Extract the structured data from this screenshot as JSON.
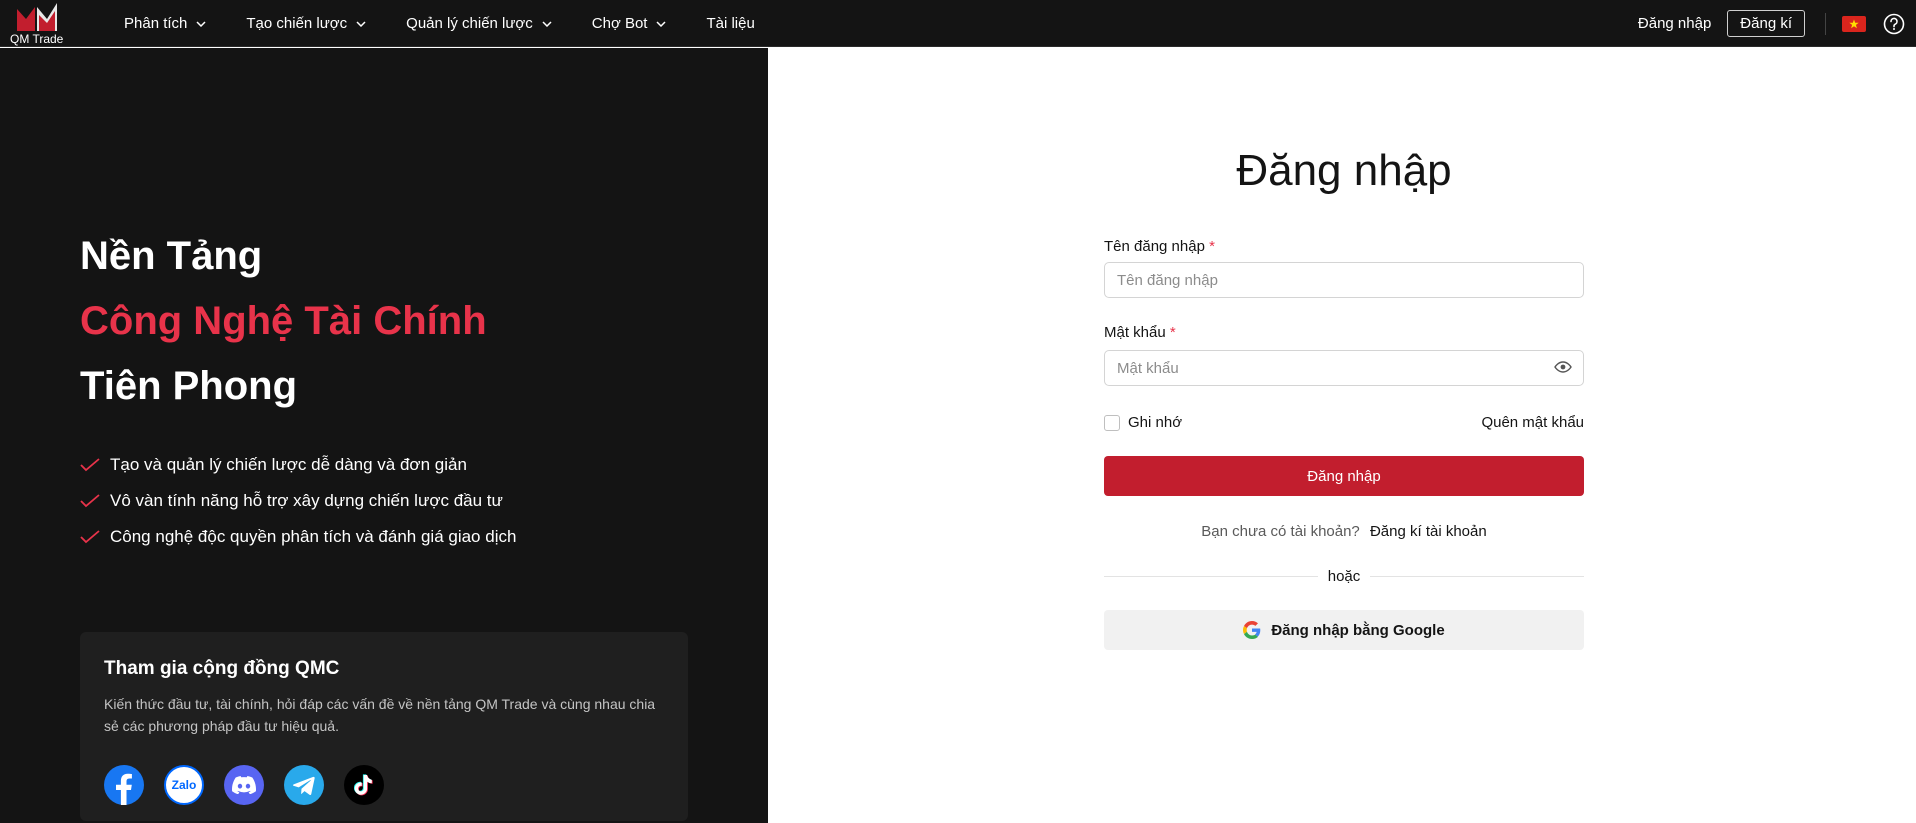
{
  "brand": {
    "name": "QM Trade",
    "accent": "#c21e2e"
  },
  "nav": {
    "items": [
      {
        "label": "Phân tích",
        "dropdown": true
      },
      {
        "label": "Tạo chiến lược",
        "dropdown": true
      },
      {
        "label": "Quản lý chiến lược",
        "dropdown": true
      },
      {
        "label": "Chợ Bot",
        "dropdown": true
      },
      {
        "label": "Tài liệu",
        "dropdown": false
      }
    ],
    "login": "Đăng nhập",
    "register": "Đăng kí",
    "language_icon": "vietnam-flag-icon",
    "help_icon": "help-icon"
  },
  "hero": {
    "line1": "Nền Tảng",
    "line2": "Công Nghệ Tài Chính",
    "line3": "Tiên Phong"
  },
  "features": [
    "Tạo và quản lý chiến lược dễ dàng và đơn giản",
    "Vô vàn tính năng hỗ trợ xây dựng chiến lược đầu tư",
    "Công nghệ độc quyền phân tích và đánh giá giao dịch"
  ],
  "community": {
    "title": "Tham gia cộng đồng QMC",
    "description": "Kiến thức đầu tư, tài chính, hỏi đáp các vấn đề về nền tảng QM Trade và cùng nhau chia sẻ các phương pháp đầu tư hiệu quả.",
    "socials": [
      "facebook-icon",
      "zalo-icon",
      "discord-icon",
      "telegram-icon",
      "tiktok-icon"
    ],
    "zalo_text": "Zalo"
  },
  "form": {
    "title": "Đăng nhập",
    "username": {
      "label": "Tên đăng nhập",
      "required": "*",
      "placeholder": "Tên đăng nhập",
      "value": ""
    },
    "password": {
      "label": "Mật khẩu",
      "required": "*",
      "placeholder": "Mật khẩu",
      "value": ""
    },
    "remember": {
      "label": "Ghi nhớ",
      "checked": false
    },
    "forgot": "Quên mật khẩu",
    "submit": "Đăng nhập",
    "no_account": "Bạn chưa có tài khoản?",
    "signup": "Đăng kí tài khoản",
    "or": "hoặc",
    "google": "Đăng nhập bằng Google"
  }
}
